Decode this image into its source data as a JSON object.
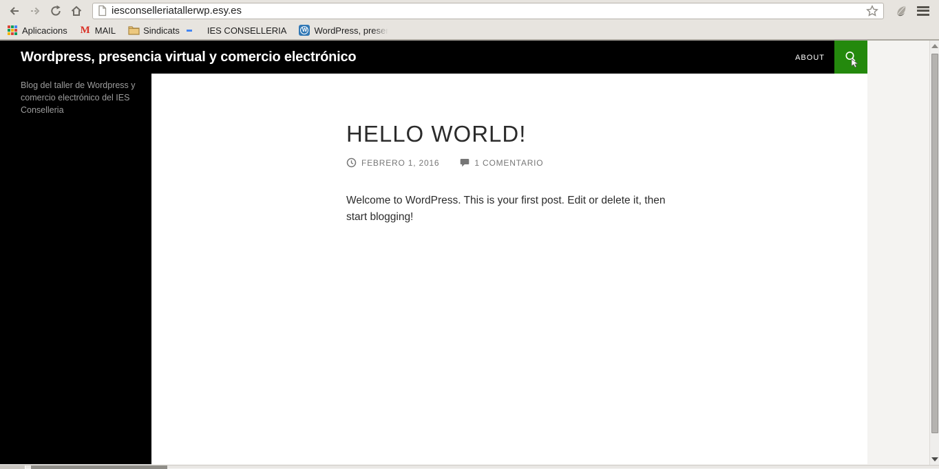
{
  "browser": {
    "url": "iesconselleriatallerwp.esy.es",
    "toolbar": {
      "back": "back",
      "forward": "forward",
      "reload": "reload",
      "home": "home",
      "bookmark_star": "bookmark-star",
      "menu": "menu"
    },
    "bookmarks": [
      {
        "label": "Aplicacions",
        "icon": "apps-grid-icon"
      },
      {
        "label": "MAIL",
        "icon": "gmail-icon"
      },
      {
        "label": "Sindicats",
        "icon": "folder-icon"
      },
      {
        "label": "IES CONSELLERIA",
        "icon": "google-g-icon"
      },
      {
        "label": "WordPress, presen",
        "icon": "wordpress-icon"
      }
    ]
  },
  "site": {
    "header": {
      "title": "Wordpress, presencia virtual y comercio electrónico",
      "about_label": "ABOUT",
      "search_icon": "magnifier",
      "accent_green": "#24890d",
      "background": "#000000"
    },
    "sidebar": {
      "description": "Blog del taller de Wordpress y comercio electrónico del IES Conselleria"
    },
    "post": {
      "title": "HELLO WORLD!",
      "date": "FEBRERO 1, 2016",
      "comments": "1 COMENTARIO",
      "body": "Welcome to WordPress. This is your first post. Edit or delete it, then start blogging!"
    }
  },
  "colors": {
    "chrome_bg": "#e7e4df",
    "accent_green": "#24890d",
    "heading_text": "#2b2b2b",
    "meta_text": "#767676",
    "gutter": "#f4f3f1"
  }
}
